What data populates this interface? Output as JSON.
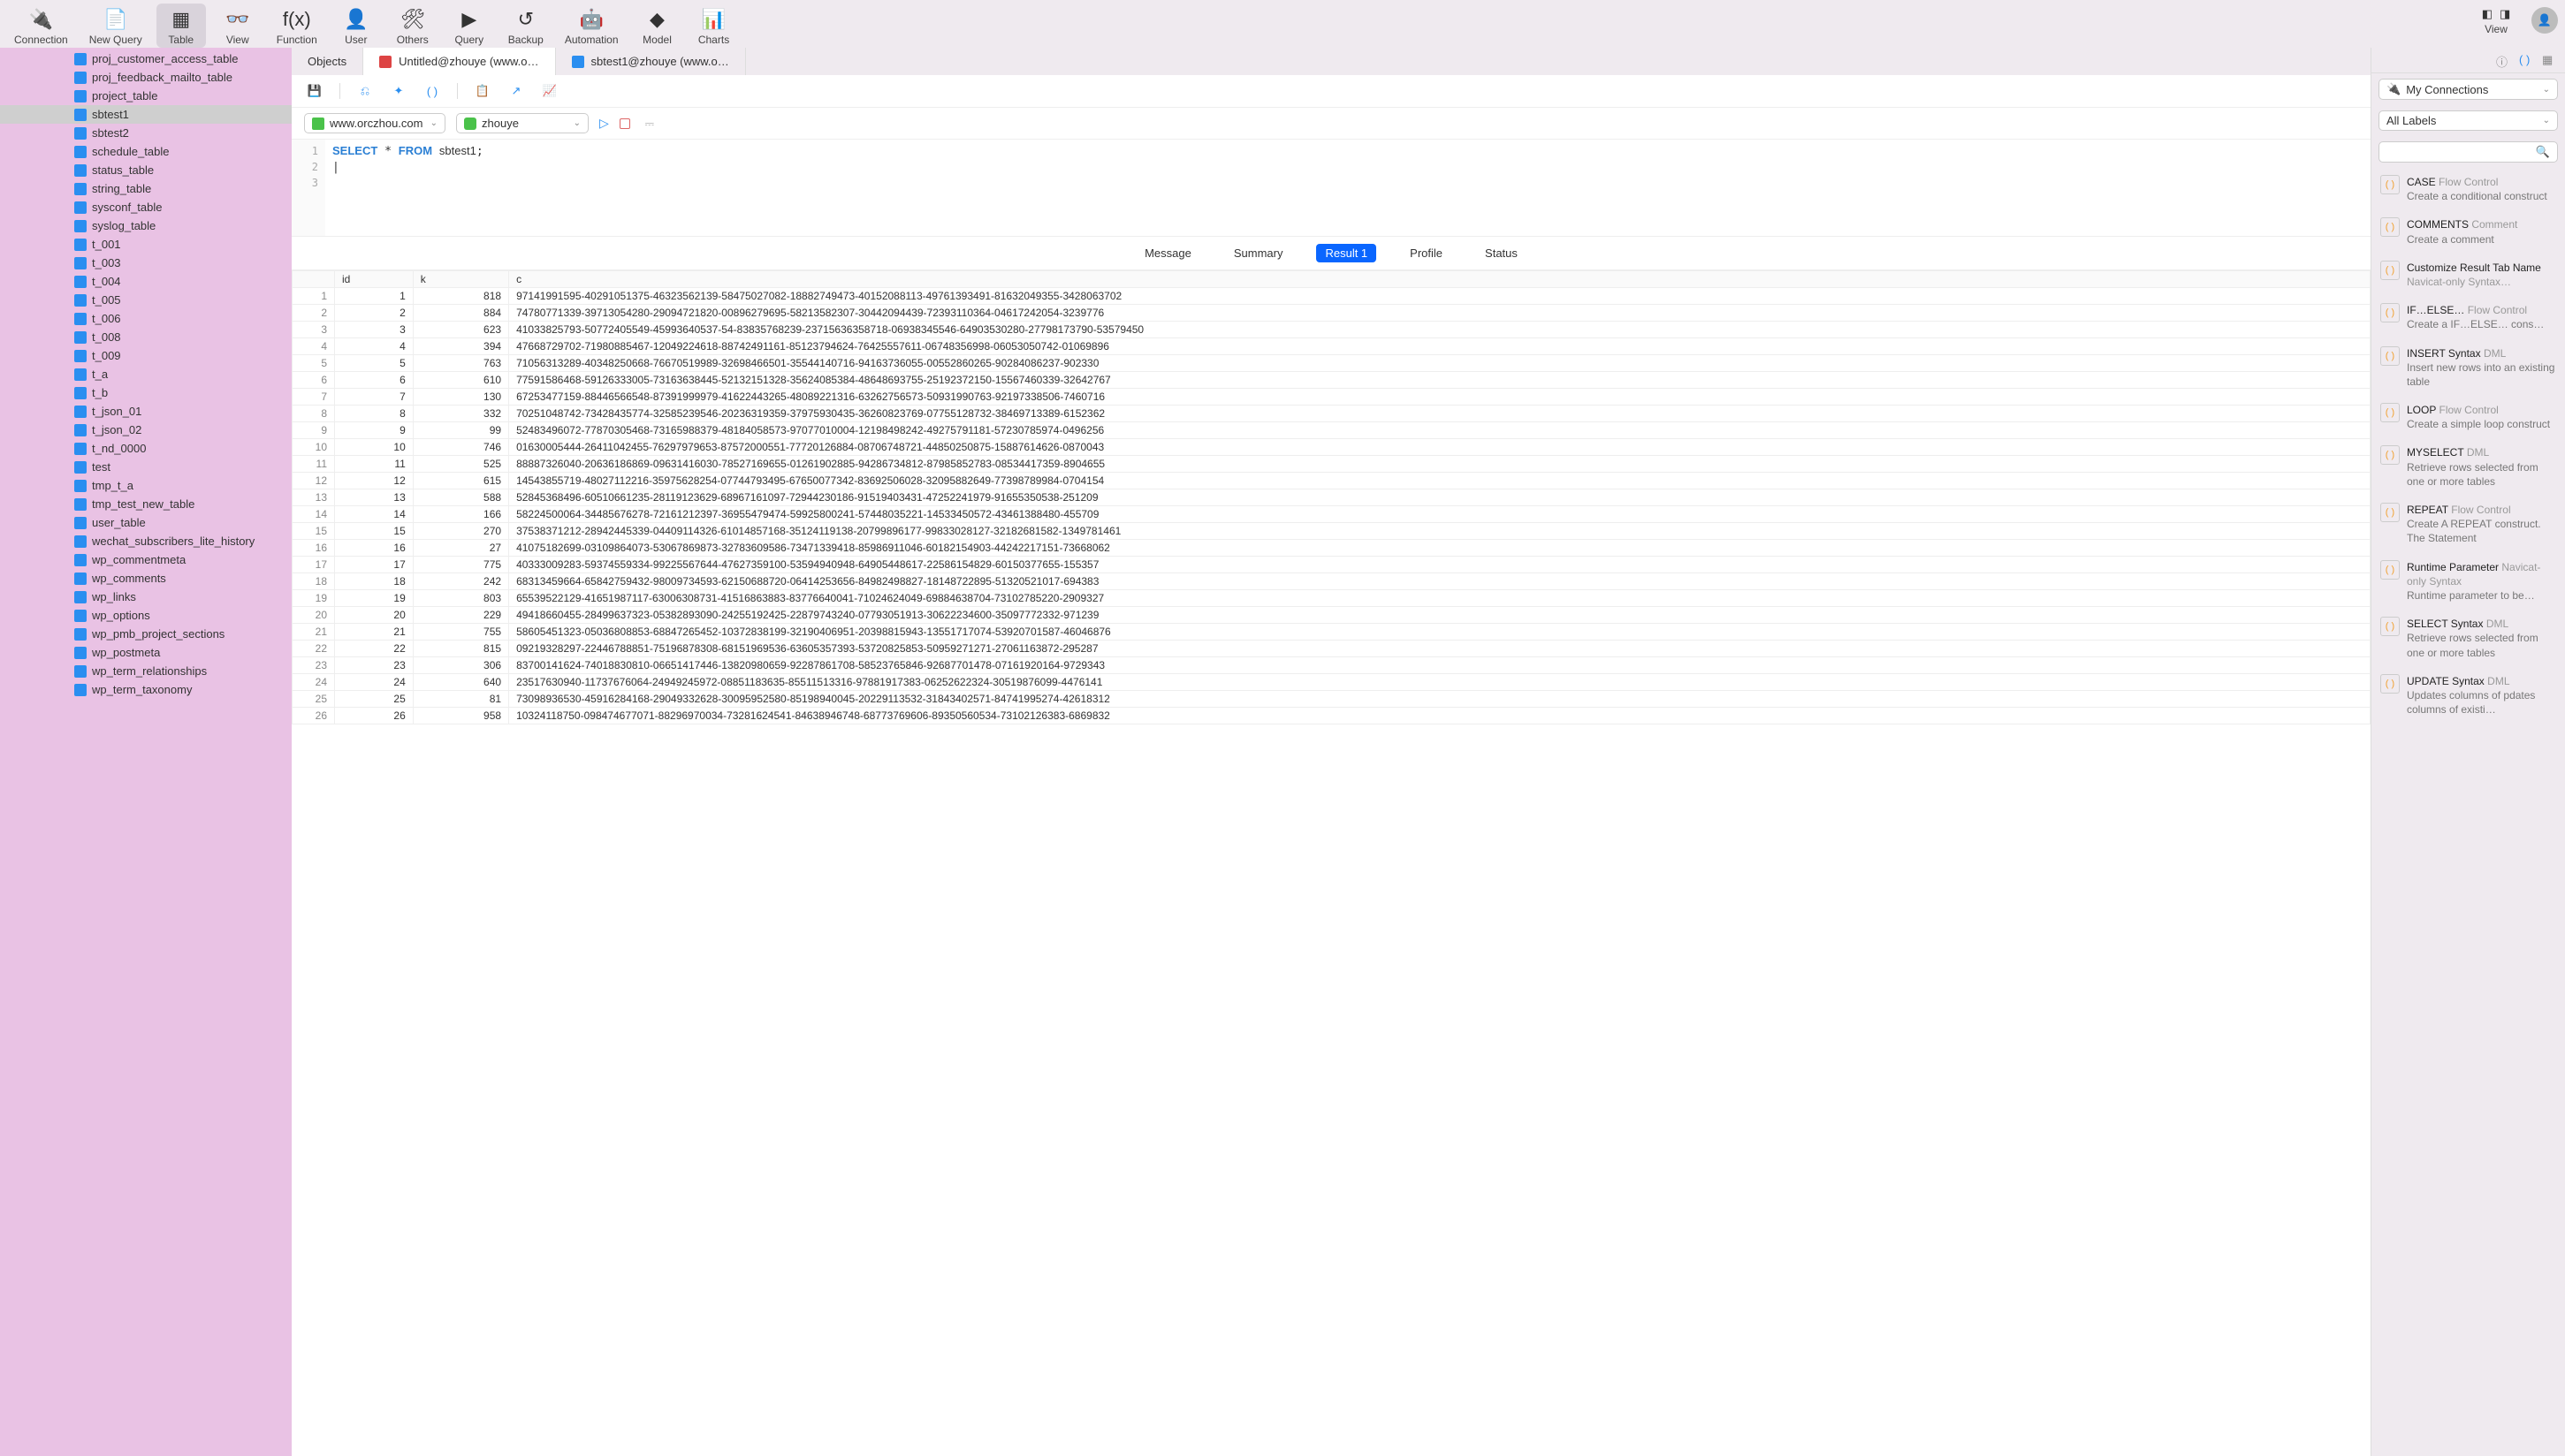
{
  "toolbar": {
    "items": [
      {
        "label": "Connection",
        "icon": "🔌"
      },
      {
        "label": "New Query",
        "icon": "📄"
      },
      {
        "label": "Table",
        "icon": "▦",
        "active": true
      },
      {
        "label": "View",
        "icon": "👓"
      },
      {
        "label": "Function",
        "icon": "f(x)"
      },
      {
        "label": "User",
        "icon": "👤"
      },
      {
        "label": "Others",
        "icon": "🛠"
      },
      {
        "label": "Query",
        "icon": "▶"
      },
      {
        "label": "Backup",
        "icon": "↺"
      },
      {
        "label": "Automation",
        "icon": "🤖"
      },
      {
        "label": "Model",
        "icon": "◆"
      },
      {
        "label": "Charts",
        "icon": "📊"
      }
    ],
    "view_label": "View"
  },
  "sidebar": {
    "items": [
      "proj_customer_access_table",
      "proj_feedback_mailto_table",
      "project_table",
      "sbtest1",
      "sbtest2",
      "schedule_table",
      "status_table",
      "string_table",
      "sysconf_table",
      "syslog_table",
      "t_001",
      "t_003",
      "t_004",
      "t_005",
      "t_006",
      "t_008",
      "t_009",
      "t_a",
      "t_b",
      "t_json_01",
      "t_json_02",
      "t_nd_0000",
      "test",
      "tmp_t_a",
      "tmp_test_new_table",
      "user_table",
      "wechat_subscribers_lite_history",
      "wp_commentmeta",
      "wp_comments",
      "wp_links",
      "wp_options",
      "wp_pmb_project_sections",
      "wp_postmeta",
      "wp_term_relationships",
      "wp_term_taxonomy"
    ],
    "selected": "sbtest1"
  },
  "tabs": [
    {
      "label": "Objects",
      "icon": null
    },
    {
      "label": "Untitled@zhouye (www.o…",
      "icon": "#d44",
      "active": true
    },
    {
      "label": "sbtest1@zhouye (www.o…",
      "icon": "#2a8ef0"
    }
  ],
  "conn": {
    "host": "www.orczhou.com",
    "db": "zhouye"
  },
  "sql": {
    "lines": [
      "SELECT * FROM sbtest1;",
      "",
      ""
    ]
  },
  "result_tabs": [
    "Message",
    "Summary",
    "Result 1",
    "Profile",
    "Status"
  ],
  "result_active": "Result 1",
  "columns": [
    "",
    "id",
    "k",
    "c"
  ],
  "rows": [
    [
      "1",
      "818",
      "97141991595-40291051375-46323562139-58475027082-18882749473-40152088113-49761393491-81632049355-3428063702"
    ],
    [
      "2",
      "884",
      "74780771339-39713054280-29094721820-00896279695-58213582307-30442094439-72393110364-04617242054-3239776"
    ],
    [
      "3",
      "623",
      "41033825793-50772405549-45993640537-54-83835768239-23715636358718-06938345546-64903530280-27798173790-53579450"
    ],
    [
      "4",
      "394",
      "47668729702-71980885467-12049224618-88742491161-85123794624-76425557611-06748356998-06053050742-01069896"
    ],
    [
      "5",
      "763",
      "71056313289-40348250668-76670519989-32698466501-35544140716-94163736055-00552860265-90284086237-902330"
    ],
    [
      "6",
      "610",
      "77591586468-59126333005-73163638445-52132151328-35624085384-48648693755-25192372150-15567460339-32642767"
    ],
    [
      "7",
      "130",
      "67253477159-88446566548-87391999979-41622443265-48089221316-63262756573-50931990763-92197338506-7460716"
    ],
    [
      "8",
      "332",
      "70251048742-73428435774-32585239546-20236319359-37975930435-36260823769-07755128732-38469713389-6152362"
    ],
    [
      "9",
      "99",
      "52483496072-77870305468-73165988379-48184058573-97077010004-12198498242-49275791181-57230785974-0496256"
    ],
    [
      "10",
      "746",
      "01630005444-26411042455-76297979653-87572000551-77720126884-08706748721-44850250875-15887614626-0870043"
    ],
    [
      "11",
      "525",
      "88887326040-20636186869-09631416030-78527169655-01261902885-94286734812-87985852783-08534417359-8904655"
    ],
    [
      "12",
      "615",
      "14543855719-48027112216-35975628254-07744793495-67650077342-83692506028-32095882649-77398789984-0704154"
    ],
    [
      "13",
      "588",
      "52845368496-60510661235-28119123629-68967161097-72944230186-91519403431-47252241979-91655350538-251209"
    ],
    [
      "14",
      "166",
      "58224500064-34485676278-72161212397-36955479474-59925800241-57448035221-14533450572-43461388480-455709"
    ],
    [
      "15",
      "270",
      "37538371212-28942445339-04409114326-61014857168-35124119138-20799896177-99833028127-32182681582-1349781461"
    ],
    [
      "16",
      "27",
      "41075182699-03109864073-53067869873-32783609586-73471339418-85986911046-60182154903-44242217151-73668062"
    ],
    [
      "17",
      "775",
      "40333009283-59374559334-99225567644-47627359100-53594940948-64905448617-22586154829-60150377655-155357"
    ],
    [
      "18",
      "242",
      "68313459664-65842759432-98009734593-62150688720-06414253656-84982498827-18148722895-51320521017-694383"
    ],
    [
      "19",
      "803",
      "65539522129-41651987117-63006308731-41516863883-83776640041-71024624049-69884638704-73102785220-2909327"
    ],
    [
      "20",
      "229",
      "49418660455-28499637323-05382893090-24255192425-22879743240-07793051913-30622234600-35097772332-971239"
    ],
    [
      "21",
      "755",
      "58605451323-05036808853-68847265452-10372838199-32190406951-20398815943-13551717074-53920701587-46046876"
    ],
    [
      "22",
      "815",
      "09219328297-22446788851-75196878308-68151969536-63605357393-53720825853-50959271271-27061163872-295287"
    ],
    [
      "23",
      "306",
      "83700141624-74018830810-06651417446-13820980659-92287861708-58523765846-92687701478-07161920164-9729343"
    ],
    [
      "24",
      "640",
      "23517630940-11737676064-24949245972-08851183635-85511513316-97881917383-06252622324-30519876099-4476141"
    ],
    [
      "25",
      "81",
      "73098936530-45916284168-29049332628-30095952580-85198940045-20229113532-31843402571-84741995274-42618312"
    ],
    [
      "26",
      "958",
      "10324118750-098474677071-88296970034-73281624541-84638946748-68773769606-89350560534-73102126383-6869832"
    ]
  ],
  "right": {
    "conn_label": "My Connections",
    "labels_label": "All Labels",
    "snippets": [
      {
        "title": "CASE",
        "tag": "Flow Control",
        "desc": "Create a conditional construct"
      },
      {
        "title": "COMMENTS",
        "tag": "Comment",
        "desc": "Create a comment"
      },
      {
        "title": "Customize Result Tab Name",
        "tag": "Navicat-only Syntax…",
        "desc": ""
      },
      {
        "title": "IF…ELSE…",
        "tag": "Flow Control",
        "desc": "Create a IF…ELSE… cons…"
      },
      {
        "title": "INSERT Syntax",
        "tag": "DML",
        "desc": "Insert new rows into an existing table"
      },
      {
        "title": "LOOP",
        "tag": "Flow Control",
        "desc": "Create a simple loop construct"
      },
      {
        "title": "MYSELECT",
        "tag": "DML",
        "desc": "Retrieve rows selected from one or more tables"
      },
      {
        "title": "REPEAT",
        "tag": "Flow Control",
        "desc": "Create A REPEAT construct. The Statement"
      },
      {
        "title": "Runtime Parameter",
        "tag": "Navicat-only Syntax",
        "desc": "Runtime parameter to be…"
      },
      {
        "title": "SELECT Syntax",
        "tag": "DML",
        "desc": "Retrieve rows selected from one or more tables"
      },
      {
        "title": "UPDATE Syntax",
        "tag": "DML",
        "desc": "Updates columns of pdates columns of existi…"
      }
    ]
  }
}
